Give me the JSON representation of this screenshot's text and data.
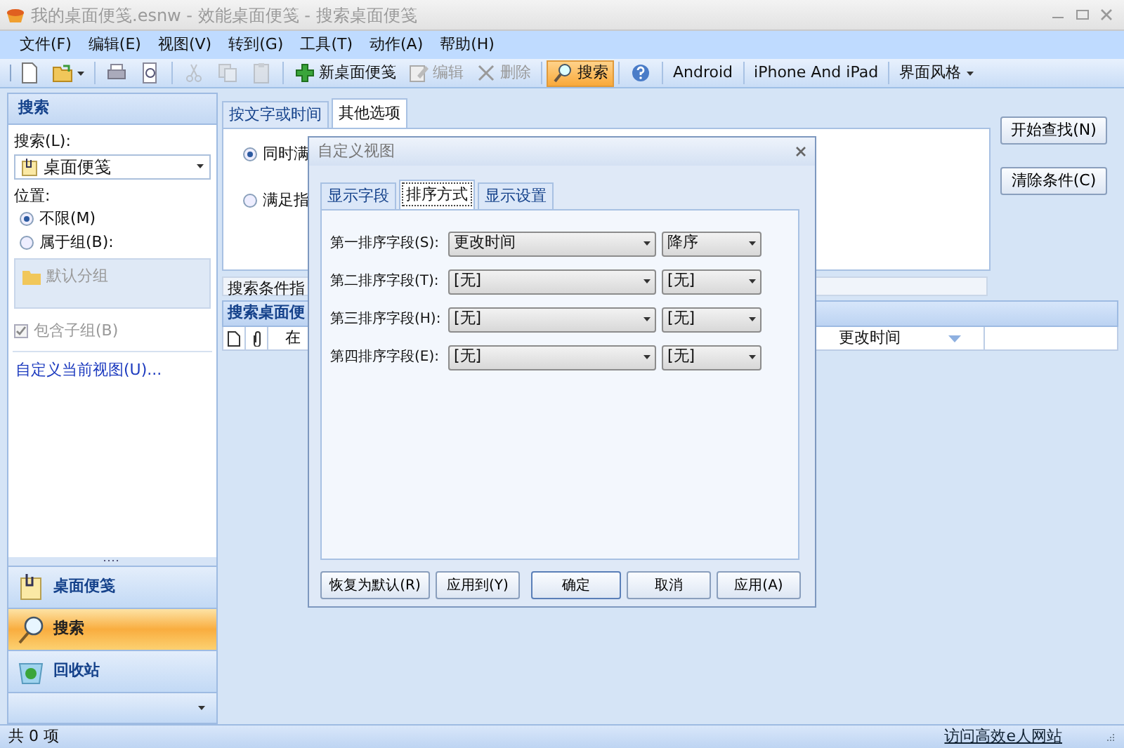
{
  "window": {
    "title": "我的桌面便笺.esnw - 效能桌面便笺 - 搜索桌面便笺"
  },
  "menu": [
    "文件(F)",
    "编辑(E)",
    "视图(V)",
    "转到(G)",
    "工具(T)",
    "动作(A)",
    "帮助(H)"
  ],
  "toolbar": [
    {
      "kind": "icon",
      "disabled": false,
      "dropdown": false
    },
    {
      "kind": "icon",
      "disabled": false,
      "dropdown": true
    },
    {
      "kind": "separator"
    },
    {
      "kind": "icon",
      "disabled": false,
      "dropdown": false
    },
    {
      "kind": "icon",
      "disabled": false,
      "dropdown": false
    },
    {
      "kind": "separator"
    },
    {
      "kind": "icon",
      "disabled": true,
      "dropdown": false
    },
    {
      "kind": "icon",
      "disabled": true,
      "dropdown": false
    },
    {
      "kind": "icon",
      "disabled": true,
      "dropdown": false
    },
    {
      "kind": "separator"
    },
    {
      "kind": "icon-text",
      "label": "新桌面便笺",
      "disabled": false,
      "selected": false
    },
    {
      "kind": "icon-text",
      "label": "编辑",
      "disabled": true,
      "selected": false
    },
    {
      "kind": "icon-text",
      "label": "删除",
      "disabled": true,
      "selected": false
    },
    {
      "kind": "separator"
    },
    {
      "kind": "icon-text",
      "label": "搜索",
      "disabled": false,
      "selected": true
    },
    {
      "kind": "separator"
    },
    {
      "kind": "icon",
      "disabled": false,
      "dropdown": false
    },
    {
      "kind": "separator"
    },
    {
      "kind": "text",
      "label": "Android",
      "dropdown": false
    },
    {
      "kind": "separator"
    },
    {
      "kind": "text",
      "label": "iPhone And iPad",
      "dropdown": false
    },
    {
      "kind": "separator"
    },
    {
      "kind": "text",
      "label": "界面风格",
      "dropdown": true
    }
  ],
  "search_pane": {
    "title": "搜索",
    "search_label": "搜索(L):",
    "search_combo": "桌面便笺",
    "location_label": "位置:",
    "location_options": [
      {
        "label": "不限(M)",
        "selected": true
      },
      {
        "label": "属于组(B):",
        "selected": false
      }
    ],
    "groups": [
      {
        "label": "默认分组",
        "disabled": true
      }
    ],
    "include_subgroups": {
      "label": "包含子组(B)",
      "checked": true,
      "disabled": true
    },
    "customize_link": "自定义当前视图(U)..."
  },
  "navigation": [
    {
      "label": "桌面便笺",
      "selected": false
    },
    {
      "label": "搜索",
      "selected": true
    },
    {
      "label": "回收站",
      "selected": false
    }
  ],
  "criteria_tabs": [
    {
      "label": "按文字或时间",
      "selected": false
    },
    {
      "label": "其他选项",
      "selected": true
    }
  ],
  "match_options": [
    {
      "label": "同时满",
      "selected": true
    },
    {
      "label": "满足指",
      "selected": false
    }
  ],
  "actions": [
    "开始查找(N)",
    "清除条件(C)"
  ],
  "criteria_summary": "搜索条件指",
  "results": {
    "title": "搜索桌面便",
    "columns": [
      {
        "label": "在"
      },
      {
        "label": "更改时间",
        "sorted": true
      }
    ]
  },
  "dialog": {
    "title": "自定义视图",
    "tabs": [
      {
        "label": "显示字段",
        "selected": false
      },
      {
        "label": "排序方式",
        "selected": true
      },
      {
        "label": "显示设置",
        "selected": false
      }
    ],
    "sort_fields": [
      {
        "label": "第一排序字段(S):",
        "field": "更改时间",
        "order": "降序"
      },
      {
        "label": "第二排序字段(T):",
        "field": "[无]",
        "order": "[无]"
      },
      {
        "label": "第三排序字段(H):",
        "field": "[无]",
        "order": "[无]"
      },
      {
        "label": "第四排序字段(E):",
        "field": "[无]",
        "order": "[无]"
      }
    ],
    "buttons": [
      {
        "label": "恢复为默认(R)",
        "default": false
      },
      {
        "label": "应用到(Y)",
        "default": false
      },
      {
        "label": "确定",
        "default": true
      },
      {
        "label": "取消",
        "default": false
      },
      {
        "label": "应用(A)",
        "default": false
      }
    ]
  },
  "status_bar": {
    "count": "共 0 项",
    "link": "访问高效e人网站"
  }
}
